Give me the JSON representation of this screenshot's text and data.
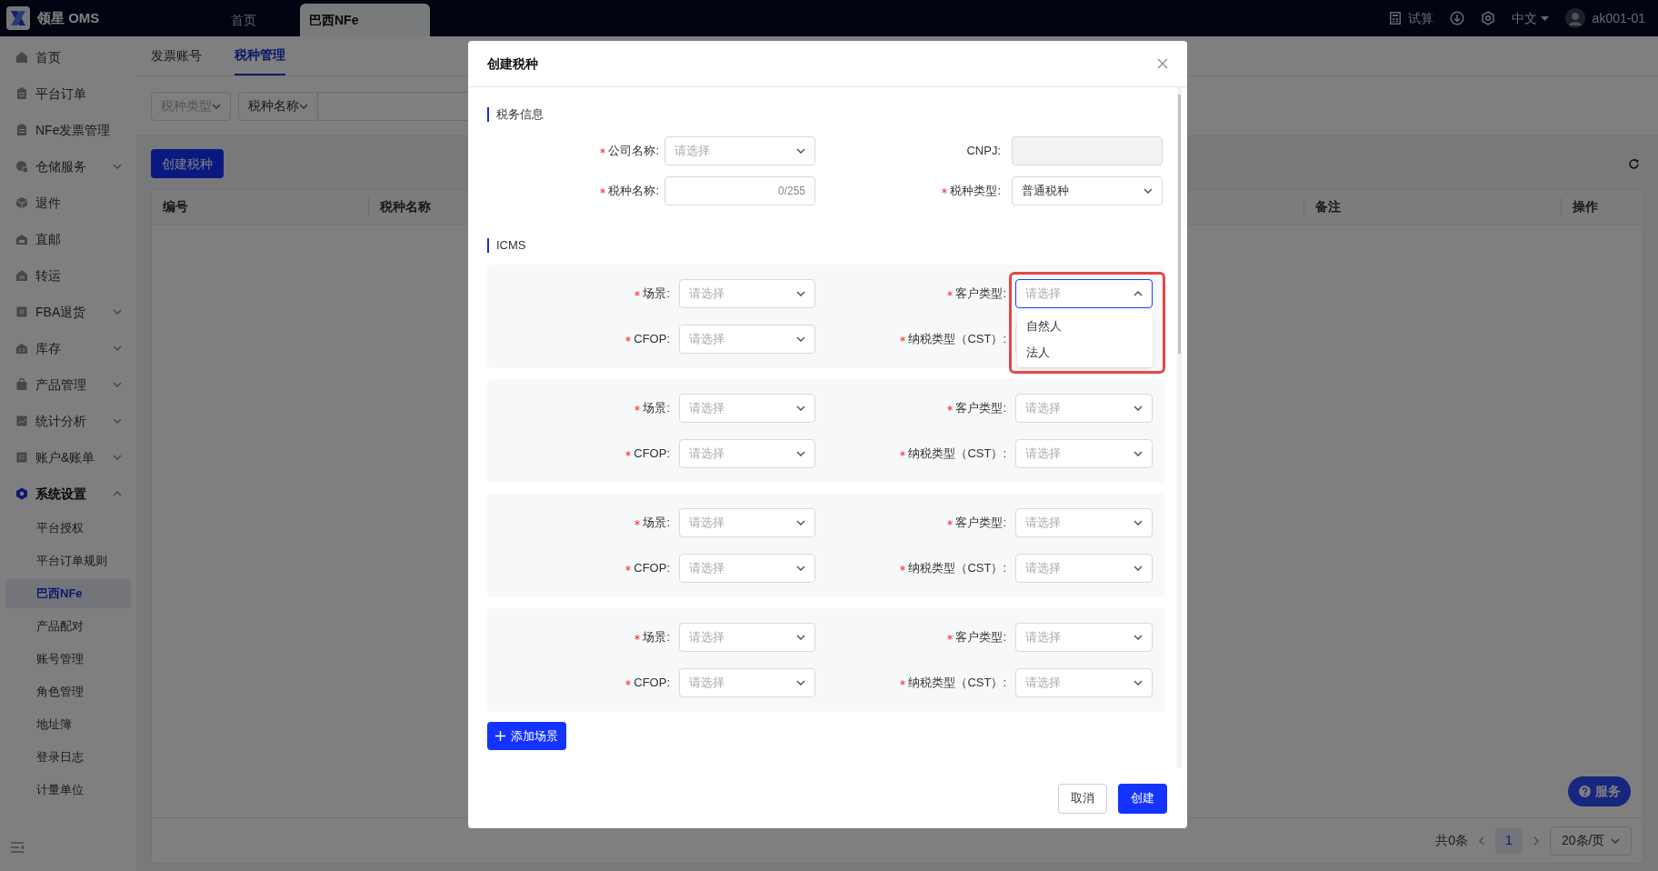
{
  "app": {
    "logo_text": "领星 OMS"
  },
  "top_tabs": [
    {
      "label": "首页",
      "selected": false
    },
    {
      "label": "巴西NFe",
      "selected": true
    }
  ],
  "header": {
    "calculator": "试算",
    "language": "中文",
    "user": "ak001-01"
  },
  "sidebar": {
    "items": [
      {
        "label": "首页",
        "kind": "link"
      },
      {
        "label": "平台订单",
        "kind": "link"
      },
      {
        "label": "NFe发票管理",
        "kind": "link"
      },
      {
        "label": "仓储服务",
        "kind": "group",
        "expanded": false
      },
      {
        "label": "退件",
        "kind": "link"
      },
      {
        "label": "直邮",
        "kind": "link"
      },
      {
        "label": "转运",
        "kind": "link"
      },
      {
        "label": "FBA退货",
        "kind": "group",
        "expanded": false
      },
      {
        "label": "库存",
        "kind": "group",
        "expanded": false
      },
      {
        "label": "产品管理",
        "kind": "group",
        "expanded": false
      },
      {
        "label": "统计分析",
        "kind": "group",
        "expanded": false
      },
      {
        "label": "账户&账单",
        "kind": "group",
        "expanded": false
      },
      {
        "label": "系统设置",
        "kind": "group",
        "expanded": true,
        "children": [
          {
            "label": "平台授权",
            "selected": false
          },
          {
            "label": "平台订单规则",
            "selected": false
          },
          {
            "label": "巴西NFe",
            "selected": true
          },
          {
            "label": "产品配对",
            "selected": false
          },
          {
            "label": "账号管理",
            "selected": false
          },
          {
            "label": "角色管理",
            "selected": false
          },
          {
            "label": "地址簿",
            "selected": false
          },
          {
            "label": "登录日志",
            "selected": false
          },
          {
            "label": "计量单位",
            "selected": false
          }
        ]
      }
    ]
  },
  "sub_tabs": [
    {
      "label": "发票账号",
      "selected": false
    },
    {
      "label": "税种管理",
      "selected": true
    }
  ],
  "filters": [
    {
      "placeholder": "税种类型"
    },
    {
      "value": "税种名称"
    }
  ],
  "create_button": "创建税种",
  "table": {
    "columns": [
      "编号",
      "税种名称",
      "备注",
      "操作"
    ]
  },
  "pagination": {
    "total": "共0条",
    "pages": [
      {
        "label": "1",
        "selected": true
      }
    ],
    "page_size": "20条/页"
  },
  "service_button": "服务",
  "dialog": {
    "title": "创建税种",
    "tax_section": "税务信息",
    "tax_fields": [
      {
        "label": "公司名称:",
        "required": true,
        "kind": "select",
        "placeholder": "请选择"
      },
      {
        "label": "CNPJ:",
        "required": false,
        "kind": "input",
        "disabled": true
      },
      {
        "label": "税种名称:",
        "required": true,
        "kind": "input",
        "counter": "0/255"
      },
      {
        "label": "税种类型:",
        "required": true,
        "kind": "select",
        "value": "普通税种"
      }
    ],
    "icms_section": "ICMS",
    "scenarios": [
      {
        "fields": [
          {
            "label": "场景:",
            "placeholder": "请选择",
            "open": false
          },
          {
            "label": "客户类型:",
            "placeholder": "请选择",
            "open": true,
            "highlighted": true,
            "options": [
              "自然人",
              "法人"
            ]
          },
          {
            "label": "CFOP:",
            "placeholder": "请选择",
            "open": false
          },
          {
            "label": "纳税类型（CST）:",
            "open": false
          }
        ]
      },
      {
        "fields": [
          {
            "label": "场景:",
            "placeholder": "请选择",
            "open": false
          },
          {
            "label": "客户类型:",
            "placeholder": "请选择",
            "open": false
          },
          {
            "label": "CFOP:",
            "placeholder": "请选择",
            "open": false
          },
          {
            "label": "纳税类型（CST）:",
            "placeholder": "请选择",
            "open": false
          }
        ]
      },
      {
        "fields": [
          {
            "label": "场景:",
            "placeholder": "请选择",
            "open": false
          },
          {
            "label": "客户类型:",
            "placeholder": "请选择",
            "open": false
          },
          {
            "label": "CFOP:",
            "placeholder": "请选择",
            "open": false
          },
          {
            "label": "纳税类型（CST）:",
            "placeholder": "请选择",
            "open": false
          }
        ]
      },
      {
        "fields": [
          {
            "label": "场景:",
            "placeholder": "请选择",
            "open": false
          },
          {
            "label": "客户类型:",
            "placeholder": "请选择",
            "open": false
          },
          {
            "label": "CFOP:",
            "placeholder": "请选择",
            "open": false
          },
          {
            "label": "纳税类型（CST）:",
            "placeholder": "请选择",
            "open": false
          }
        ]
      }
    ],
    "add_button": "添加场景",
    "buttons": [
      {
        "label": "取消",
        "kind": "secondary"
      },
      {
        "label": "创建",
        "kind": "primary"
      }
    ]
  }
}
